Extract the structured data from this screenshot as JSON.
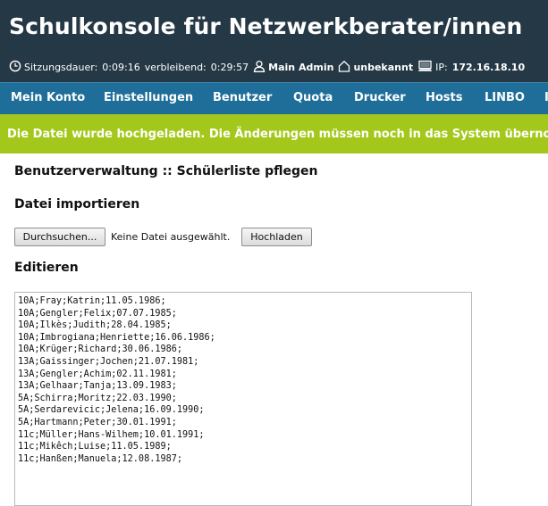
{
  "header": {
    "title": "Schulkonsole für Netzwerkberater/innen",
    "session_label": "Sitzungsdauer:",
    "session_duration": "0:09:16",
    "remaining_label": "verbleibend:",
    "remaining_time": "0:29:57",
    "user_name": "Main Admin",
    "room_name": "unbekannt",
    "ip_label": "IP:",
    "ip_address": "172.16.18.10"
  },
  "nav": {
    "items": [
      "Mein Konto",
      "Einstellungen",
      "Benutzer",
      "Quota",
      "Drucker",
      "Hosts",
      "LINBO"
    ]
  },
  "banner": {
    "message": "Die Datei wurde hochgeladen. Die Änderungen müssen noch in das System übernom"
  },
  "main": {
    "page_title": "Benutzerverwaltung :: Schülerliste pflegen",
    "import_title": "Datei importieren",
    "browse_button": "Durchsuchen...",
    "no_file_label": "Keine Datei ausgewählt.",
    "upload_button": "Hochladen",
    "edit_title": "Editieren",
    "student_list": "10A;Fray;Katrin;11.05.1986;\n10A;Gengler;Felix;07.07.1985;\n10A;Ilkès;Judith;28.04.1985;\n10A;Imbrogiana;Henriette;16.06.1986;\n10A;Krüger;Richard;30.06.1986;\n13A;Gaissinger;Jochen;21.07.1981;\n13A;Gengler;Achim;02.11.1981;\n13A;Gelhaar;Tanja;13.09.1983;\n5A;Schirra;Moritz;22.03.1990;\n5A;Serdarevicic;Jelena;16.09.1990;\n5A;Hartmann;Peter;30.01.1991;\n11c;Müller;Hans-Wilhem;10.01.1991;\n11c;Mikêch;Luise;11.05.1989;\n11c;Hanßen;Manuela;12.08.1987;"
  },
  "colors": {
    "header_bg": "#253845",
    "nav_bg": "#1f6e99",
    "banner_bg": "#a3c81b"
  },
  "icons": {
    "clock": "clock-icon",
    "user": "user-icon",
    "room": "house-icon",
    "workstation": "computer-icon"
  }
}
